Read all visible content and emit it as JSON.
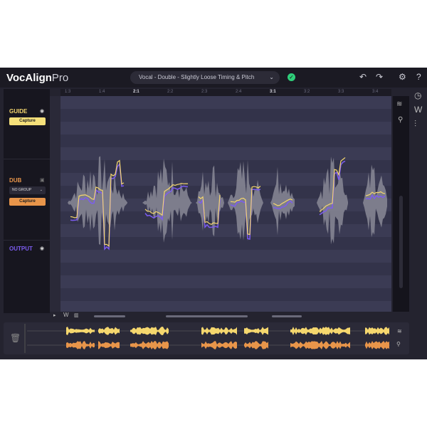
{
  "app": {
    "title": "VocAlign",
    "title_suffix": "Pro"
  },
  "preset": {
    "value": "Vocal - Double - Slightly Loose Timing & Pitch"
  },
  "ruler": {
    "ticks": [
      "1:3",
      "1:4",
      "2:1",
      "2:2",
      "2:3",
      "2:4",
      "3:1",
      "3:2",
      "3:3",
      "3:4"
    ],
    "bold": [
      "2:1",
      "3:1"
    ]
  },
  "tracks": {
    "guide": {
      "label": "GUIDE",
      "capture": "Capture",
      "color": "#f5d76e"
    },
    "dub": {
      "label": "DUB",
      "group": "NO GROUP",
      "capture": "Capture",
      "color": "#e8954a"
    },
    "output": {
      "label": "OUTPUT",
      "color": "#7c5cf0"
    }
  },
  "icons": [
    "undo-icon",
    "redo-icon",
    "gear-icon",
    "help-icon",
    "clock-icon",
    "waveform-icon",
    "mixer-icon",
    "zoom-icon",
    "trash-icon"
  ],
  "colors": {
    "guide": "#f5d76e",
    "dub": "#e8954a",
    "output": "#7c5cf0"
  }
}
